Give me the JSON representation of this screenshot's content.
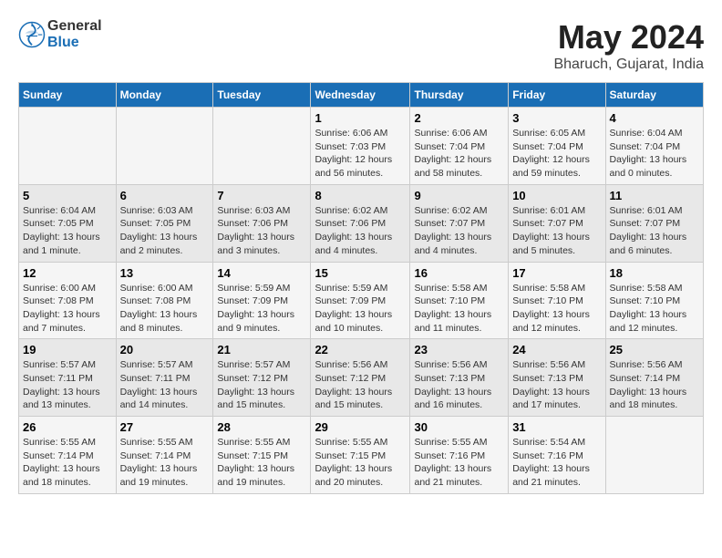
{
  "header": {
    "logo_general": "General",
    "logo_blue": "Blue",
    "month_year": "May 2024",
    "location": "Bharuch, Gujarat, India"
  },
  "days_of_week": [
    "Sunday",
    "Monday",
    "Tuesday",
    "Wednesday",
    "Thursday",
    "Friday",
    "Saturday"
  ],
  "weeks": [
    {
      "days": [
        {
          "num": "",
          "info": ""
        },
        {
          "num": "",
          "info": ""
        },
        {
          "num": "",
          "info": ""
        },
        {
          "num": "1",
          "info": "Sunrise: 6:06 AM\nSunset: 7:03 PM\nDaylight: 12 hours and 56 minutes."
        },
        {
          "num": "2",
          "info": "Sunrise: 6:06 AM\nSunset: 7:04 PM\nDaylight: 12 hours and 58 minutes."
        },
        {
          "num": "3",
          "info": "Sunrise: 6:05 AM\nSunset: 7:04 PM\nDaylight: 12 hours and 59 minutes."
        },
        {
          "num": "4",
          "info": "Sunrise: 6:04 AM\nSunset: 7:04 PM\nDaylight: 13 hours and 0 minutes."
        }
      ]
    },
    {
      "days": [
        {
          "num": "5",
          "info": "Sunrise: 6:04 AM\nSunset: 7:05 PM\nDaylight: 13 hours and 1 minute."
        },
        {
          "num": "6",
          "info": "Sunrise: 6:03 AM\nSunset: 7:05 PM\nDaylight: 13 hours and 2 minutes."
        },
        {
          "num": "7",
          "info": "Sunrise: 6:03 AM\nSunset: 7:06 PM\nDaylight: 13 hours and 3 minutes."
        },
        {
          "num": "8",
          "info": "Sunrise: 6:02 AM\nSunset: 7:06 PM\nDaylight: 13 hours and 4 minutes."
        },
        {
          "num": "9",
          "info": "Sunrise: 6:02 AM\nSunset: 7:07 PM\nDaylight: 13 hours and 4 minutes."
        },
        {
          "num": "10",
          "info": "Sunrise: 6:01 AM\nSunset: 7:07 PM\nDaylight: 13 hours and 5 minutes."
        },
        {
          "num": "11",
          "info": "Sunrise: 6:01 AM\nSunset: 7:07 PM\nDaylight: 13 hours and 6 minutes."
        }
      ]
    },
    {
      "days": [
        {
          "num": "12",
          "info": "Sunrise: 6:00 AM\nSunset: 7:08 PM\nDaylight: 13 hours and 7 minutes."
        },
        {
          "num": "13",
          "info": "Sunrise: 6:00 AM\nSunset: 7:08 PM\nDaylight: 13 hours and 8 minutes."
        },
        {
          "num": "14",
          "info": "Sunrise: 5:59 AM\nSunset: 7:09 PM\nDaylight: 13 hours and 9 minutes."
        },
        {
          "num": "15",
          "info": "Sunrise: 5:59 AM\nSunset: 7:09 PM\nDaylight: 13 hours and 10 minutes."
        },
        {
          "num": "16",
          "info": "Sunrise: 5:58 AM\nSunset: 7:10 PM\nDaylight: 13 hours and 11 minutes."
        },
        {
          "num": "17",
          "info": "Sunrise: 5:58 AM\nSunset: 7:10 PM\nDaylight: 13 hours and 12 minutes."
        },
        {
          "num": "18",
          "info": "Sunrise: 5:58 AM\nSunset: 7:10 PM\nDaylight: 13 hours and 12 minutes."
        }
      ]
    },
    {
      "days": [
        {
          "num": "19",
          "info": "Sunrise: 5:57 AM\nSunset: 7:11 PM\nDaylight: 13 hours and 13 minutes."
        },
        {
          "num": "20",
          "info": "Sunrise: 5:57 AM\nSunset: 7:11 PM\nDaylight: 13 hours and 14 minutes."
        },
        {
          "num": "21",
          "info": "Sunrise: 5:57 AM\nSunset: 7:12 PM\nDaylight: 13 hours and 15 minutes."
        },
        {
          "num": "22",
          "info": "Sunrise: 5:56 AM\nSunset: 7:12 PM\nDaylight: 13 hours and 15 minutes."
        },
        {
          "num": "23",
          "info": "Sunrise: 5:56 AM\nSunset: 7:13 PM\nDaylight: 13 hours and 16 minutes."
        },
        {
          "num": "24",
          "info": "Sunrise: 5:56 AM\nSunset: 7:13 PM\nDaylight: 13 hours and 17 minutes."
        },
        {
          "num": "25",
          "info": "Sunrise: 5:56 AM\nSunset: 7:14 PM\nDaylight: 13 hours and 18 minutes."
        }
      ]
    },
    {
      "days": [
        {
          "num": "26",
          "info": "Sunrise: 5:55 AM\nSunset: 7:14 PM\nDaylight: 13 hours and 18 minutes."
        },
        {
          "num": "27",
          "info": "Sunrise: 5:55 AM\nSunset: 7:14 PM\nDaylight: 13 hours and 19 minutes."
        },
        {
          "num": "28",
          "info": "Sunrise: 5:55 AM\nSunset: 7:15 PM\nDaylight: 13 hours and 19 minutes."
        },
        {
          "num": "29",
          "info": "Sunrise: 5:55 AM\nSunset: 7:15 PM\nDaylight: 13 hours and 20 minutes."
        },
        {
          "num": "30",
          "info": "Sunrise: 5:55 AM\nSunset: 7:16 PM\nDaylight: 13 hours and 21 minutes."
        },
        {
          "num": "31",
          "info": "Sunrise: 5:54 AM\nSunset: 7:16 PM\nDaylight: 13 hours and 21 minutes."
        },
        {
          "num": "",
          "info": ""
        }
      ]
    }
  ]
}
